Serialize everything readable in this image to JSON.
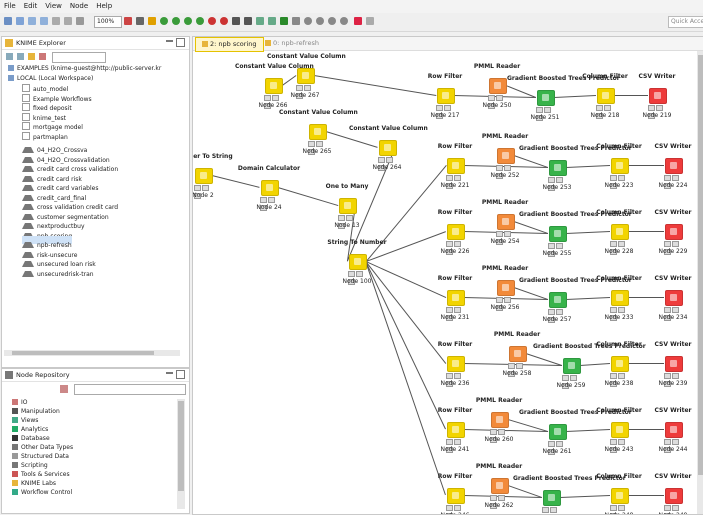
{
  "menubar": {
    "items": [
      "File",
      "Edit",
      "View",
      "Node",
      "Help"
    ]
  },
  "toolbar": {
    "zoom": "100%",
    "quick_access_placeholder": "Quick Access"
  },
  "explorer": {
    "title": "KNIME Explorer",
    "items": [
      {
        "label": "EXAMPLES (knime-guest@http://public-server.kr",
        "indent": 0,
        "kind": "server"
      },
      {
        "label": "LOCAL (Local Workspace)",
        "indent": 0,
        "kind": "local"
      },
      {
        "label": "auto_model",
        "indent": 1,
        "kind": "folder"
      },
      {
        "label": "Example Workflows",
        "indent": 1,
        "kind": "folder"
      },
      {
        "label": "fixed deposit",
        "indent": 1,
        "kind": "folder"
      },
      {
        "label": "knime_test",
        "indent": 1,
        "kind": "folder"
      },
      {
        "label": "mortgage model",
        "indent": 1,
        "kind": "folder"
      },
      {
        "label": "partmaplan",
        "indent": 1,
        "kind": "folder"
      },
      {
        "label": "04_H2O_Crossva",
        "indent": 1,
        "kind": "flow"
      },
      {
        "label": "04_H2O_Crossvalidation",
        "indent": 1,
        "kind": "flow"
      },
      {
        "label": "credit card cross validation",
        "indent": 1,
        "kind": "flow"
      },
      {
        "label": "credit card risk",
        "indent": 1,
        "kind": "flow"
      },
      {
        "label": "credit card variables",
        "indent": 1,
        "kind": "flow"
      },
      {
        "label": "credit_card_final",
        "indent": 1,
        "kind": "flow"
      },
      {
        "label": "cross validation credit card",
        "indent": 1,
        "kind": "flow"
      },
      {
        "label": "customer segmentation",
        "indent": 1,
        "kind": "flow"
      },
      {
        "label": "nextproductbuy",
        "indent": 1,
        "kind": "flow"
      },
      {
        "label": "npb scoring",
        "indent": 1,
        "kind": "flow"
      },
      {
        "label": "npb-refresh",
        "indent": 1,
        "kind": "flow",
        "selected": true
      },
      {
        "label": "risk-unsecure",
        "indent": 1,
        "kind": "flow"
      },
      {
        "label": "unsecured loan risk",
        "indent": 1,
        "kind": "flow"
      },
      {
        "label": "unsecuredrisk-tran",
        "indent": 1,
        "kind": "flow"
      }
    ]
  },
  "repository": {
    "title": "Node Repository",
    "items": [
      "IO",
      "Manipulation",
      "Views",
      "Analytics",
      "Database",
      "Other Data Types",
      "Structured Data",
      "Scripting",
      "Tools & Services",
      "KNIME Labs",
      "Workflow Control"
    ]
  },
  "editor": {
    "tabs": [
      {
        "label": "2: npb scoring",
        "active": true
      },
      {
        "label": "0: npb-refresh",
        "active": false
      }
    ],
    "nodes": [
      {
        "id": "n266",
        "title": "Constant Value Column",
        "label": "Node 266",
        "color": "#f2d400"
      },
      {
        "id": "n267",
        "title": "Constant Value Column",
        "label": "Node 267",
        "color": "#f2d400"
      },
      {
        "id": "n265",
        "title": "Constant Value Column",
        "label": "Node 265",
        "color": "#f2d400"
      },
      {
        "id": "n264",
        "title": "Constant Value Column",
        "label": "Node 264",
        "color": "#f2d400"
      },
      {
        "id": "n2",
        "title": "Number To String",
        "label": "Node 2",
        "color": "#f2d400"
      },
      {
        "id": "n24",
        "title": "Domain Calculator",
        "label": "Node 24",
        "color": "#f2d400"
      },
      {
        "id": "n13",
        "title": "One to Many",
        "label": "Node 13",
        "color": "#f2d400"
      },
      {
        "id": "n100",
        "title": "String To Number",
        "label": "Node 100",
        "color": "#f2d400"
      },
      {
        "id": "n217",
        "title": "Row Filter",
        "label": "Node 217",
        "color": "#f2d400"
      },
      {
        "id": "n250",
        "title": "PMML Reader",
        "label": "Node 250",
        "color": "#f28a3a"
      },
      {
        "id": "n251",
        "title": "Gradient Boosted Trees Predictor",
        "label": "Node 251",
        "color": "#37b34a"
      },
      {
        "id": "n218",
        "title": "Column Filter",
        "label": "Node 218",
        "color": "#f2d400"
      },
      {
        "id": "n219",
        "title": "CSV Writer",
        "label": "Node 219",
        "color": "#ee3b3b"
      },
      {
        "id": "n221",
        "title": "Row Filter",
        "label": "Node 221",
        "color": "#f2d400"
      },
      {
        "id": "n252",
        "title": "PMML Reader",
        "label": "Node 252",
        "color": "#f28a3a"
      },
      {
        "id": "n253",
        "title": "Gradient Boosted Trees Predictor",
        "label": "Node 253",
        "color": "#37b34a"
      },
      {
        "id": "n223",
        "title": "Column Filter",
        "label": "Node 223",
        "color": "#f2d400"
      },
      {
        "id": "n224",
        "title": "CSV Writer",
        "label": "Node 224",
        "color": "#ee3b3b"
      },
      {
        "id": "n226",
        "title": "Row Filter",
        "label": "Node 226",
        "color": "#f2d400"
      },
      {
        "id": "n254",
        "title": "PMML Reader",
        "label": "Node 254",
        "color": "#f28a3a"
      },
      {
        "id": "n255",
        "title": "Gradient Boosted Trees Predictor",
        "label": "Node 255",
        "color": "#37b34a"
      },
      {
        "id": "n228",
        "title": "Column Filter",
        "label": "Node 228",
        "color": "#f2d400"
      },
      {
        "id": "n229",
        "title": "CSV Writer",
        "label": "Node 229",
        "color": "#ee3b3b"
      },
      {
        "id": "n231",
        "title": "Row Filter",
        "label": "Node 231",
        "color": "#f2d400"
      },
      {
        "id": "n256",
        "title": "PMML Reader",
        "label": "Node 256",
        "color": "#f28a3a"
      },
      {
        "id": "n257",
        "title": "Gradient Boosted Trees Predictor",
        "label": "Node 257",
        "color": "#37b34a"
      },
      {
        "id": "n233",
        "title": "Column Filter",
        "label": "Node 233",
        "color": "#f2d400"
      },
      {
        "id": "n234",
        "title": "CSV Writer",
        "label": "Node 234",
        "color": "#ee3b3b"
      },
      {
        "id": "n236",
        "title": "Row Filter",
        "label": "Node 236",
        "color": "#f2d400"
      },
      {
        "id": "n258",
        "title": "PMML Reader",
        "label": "Node 258",
        "color": "#f28a3a"
      },
      {
        "id": "n259",
        "title": "Gradient Boosted Trees Predictor",
        "label": "Node 259",
        "color": "#37b34a"
      },
      {
        "id": "n238",
        "title": "Column Filter",
        "label": "Node 238",
        "color": "#f2d400"
      },
      {
        "id": "n239",
        "title": "CSV Writer",
        "label": "Node 239",
        "color": "#ee3b3b"
      },
      {
        "id": "n241",
        "title": "Row Filter",
        "label": "Node 241",
        "color": "#f2d400"
      },
      {
        "id": "n260",
        "title": "PMML Reader",
        "label": "Node 260",
        "color": "#f28a3a"
      },
      {
        "id": "n261",
        "title": "Gradient Boosted Trees Predictor",
        "label": "Node 261",
        "color": "#37b34a"
      },
      {
        "id": "n243",
        "title": "Column Filter",
        "label": "Node 243",
        "color": "#f2d400"
      },
      {
        "id": "n244",
        "title": "CSV Writer",
        "label": "Node 244",
        "color": "#ee3b3b"
      },
      {
        "id": "n246",
        "title": "Row Filter",
        "label": "Node 246",
        "color": "#f2d400"
      },
      {
        "id": "n262",
        "title": "PMML Reader",
        "label": "Node 262",
        "color": "#f28a3a"
      },
      {
        "id": "n263",
        "title": "Gradient Boosted Trees Predictor",
        "label": "",
        "color": "#37b34a"
      },
      {
        "id": "n248",
        "title": "Column Filter",
        "label": "Node 248",
        "color": "#f2d400"
      },
      {
        "id": "n249",
        "title": "CSV Writer",
        "label": "Node 249",
        "color": "#ee3b3b"
      }
    ],
    "edges": [
      [
        "n266",
        "n267"
      ],
      [
        "n267",
        "n217"
      ],
      [
        "n217",
        "n251"
      ],
      [
        "n250",
        "n251"
      ],
      [
        "n251",
        "n218"
      ],
      [
        "n218",
        "n219"
      ],
      [
        "n2",
        "n24"
      ],
      [
        "n24",
        "n13"
      ],
      [
        "n13",
        "n100"
      ],
      [
        "n265",
        "n264"
      ],
      [
        "n264",
        "n100"
      ],
      [
        "n100",
        "n221"
      ],
      [
        "n100",
        "n226"
      ],
      [
        "n100",
        "n231"
      ],
      [
        "n100",
        "n236"
      ],
      [
        "n100",
        "n241"
      ],
      [
        "n100",
        "n246"
      ],
      [
        "n221",
        "n253"
      ],
      [
        "n252",
        "n253"
      ],
      [
        "n253",
        "n223"
      ],
      [
        "n223",
        "n224"
      ],
      [
        "n226",
        "n255"
      ],
      [
        "n254",
        "n255"
      ],
      [
        "n255",
        "n228"
      ],
      [
        "n228",
        "n229"
      ],
      [
        "n231",
        "n257"
      ],
      [
        "n256",
        "n257"
      ],
      [
        "n257",
        "n233"
      ],
      [
        "n233",
        "n234"
      ],
      [
        "n236",
        "n259"
      ],
      [
        "n258",
        "n259"
      ],
      [
        "n259",
        "n238"
      ],
      [
        "n238",
        "n239"
      ],
      [
        "n241",
        "n261"
      ],
      [
        "n260",
        "n261"
      ],
      [
        "n261",
        "n243"
      ],
      [
        "n243",
        "n244"
      ],
      [
        "n246",
        "n263"
      ],
      [
        "n262",
        "n263"
      ],
      [
        "n263",
        "n248"
      ],
      [
        "n248",
        "n249"
      ]
    ]
  }
}
